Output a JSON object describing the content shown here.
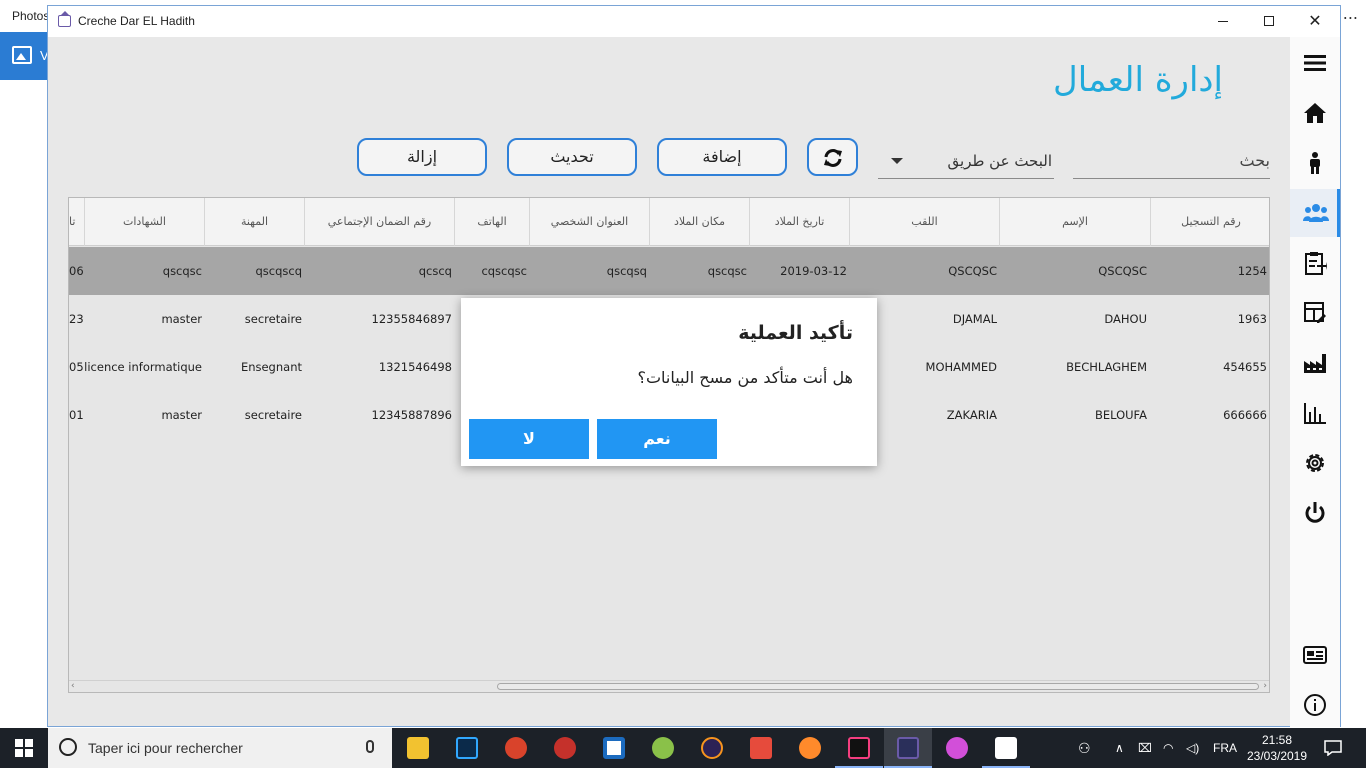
{
  "background_app": {
    "title": "Photos",
    "side_label": "V",
    "more": "..."
  },
  "window": {
    "title": "Creche Dar EL Hadith"
  },
  "page": {
    "title": "إدارة العمال"
  },
  "search": {
    "placeholder": "بحث",
    "filter_label": "البحث عن طريق"
  },
  "toolbar": {
    "add_label": "إضافة",
    "update_label": "تحديث",
    "delete_label": "إزالة"
  },
  "table": {
    "headers": [
      "رقم التسجيل",
      "الإسم",
      "اللقب",
      "تاريخ الملاد",
      "مكان الملاد",
      "العنوان الشخصي",
      "الهاتف",
      "رقم الضمان الإجتماعي",
      "المهنة",
      "الشهادات",
      "تا"
    ],
    "rows": [
      [
        "1254",
        "QSCQSC",
        "QSCQSC",
        "2019-03-12",
        "qscqsc",
        "qscqsq",
        "cqscqsc",
        "qcscq",
        "qscqscq",
        "qscqsc",
        "06"
      ],
      [
        "1963",
        "DAHOU",
        "DJAMAL",
        "",
        "",
        "",
        "",
        "12355846897",
        "secretaire",
        "master",
        "23"
      ],
      [
        "454655",
        "BECHLAGHEM",
        "MOHAMMED",
        "",
        "",
        "",
        "",
        "1321546498",
        "Ensegnant",
        "licence informatique",
        "05"
      ],
      [
        "666666",
        "BELOUFA",
        "ZAKARIA",
        "",
        "",
        "",
        "",
        "12345887896",
        "secretaire",
        "master",
        "01"
      ]
    ],
    "selected_row": 0
  },
  "dialog": {
    "title": "تأكيد العملية",
    "message": "هل أنت متأكد من مسح البيانات؟",
    "yes_label": "نعم",
    "no_label": "لا"
  },
  "taskbar": {
    "search_placeholder": "Taper ici pour rechercher",
    "language": "FRA",
    "time": "21:58",
    "date": "23/03/2019"
  },
  "colors": {
    "accent": "#2196f3",
    "title": "#22aadb",
    "button_border": "#2f80d8",
    "selected_row": "#a6a6a6"
  }
}
